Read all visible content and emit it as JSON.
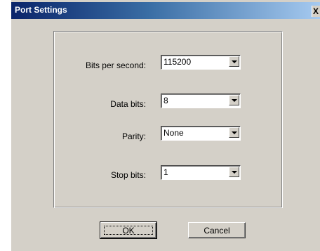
{
  "window": {
    "title": "Port Settings",
    "close_glyph": "X"
  },
  "form": {
    "bits_per_second": {
      "label": "Bits per second:",
      "value": "115200"
    },
    "data_bits": {
      "label": "Data bits:",
      "value": "8"
    },
    "parity": {
      "label": "Parity:",
      "value": "None"
    },
    "stop_bits": {
      "label": "Stop bits:",
      "value": "1"
    }
  },
  "buttons": {
    "ok": "OK",
    "cancel": "Cancel"
  },
  "colors": {
    "dialog_face": "#d4d0c8",
    "titlebar_start": "#0a246a",
    "titlebar_end": "#a6caf0"
  }
}
